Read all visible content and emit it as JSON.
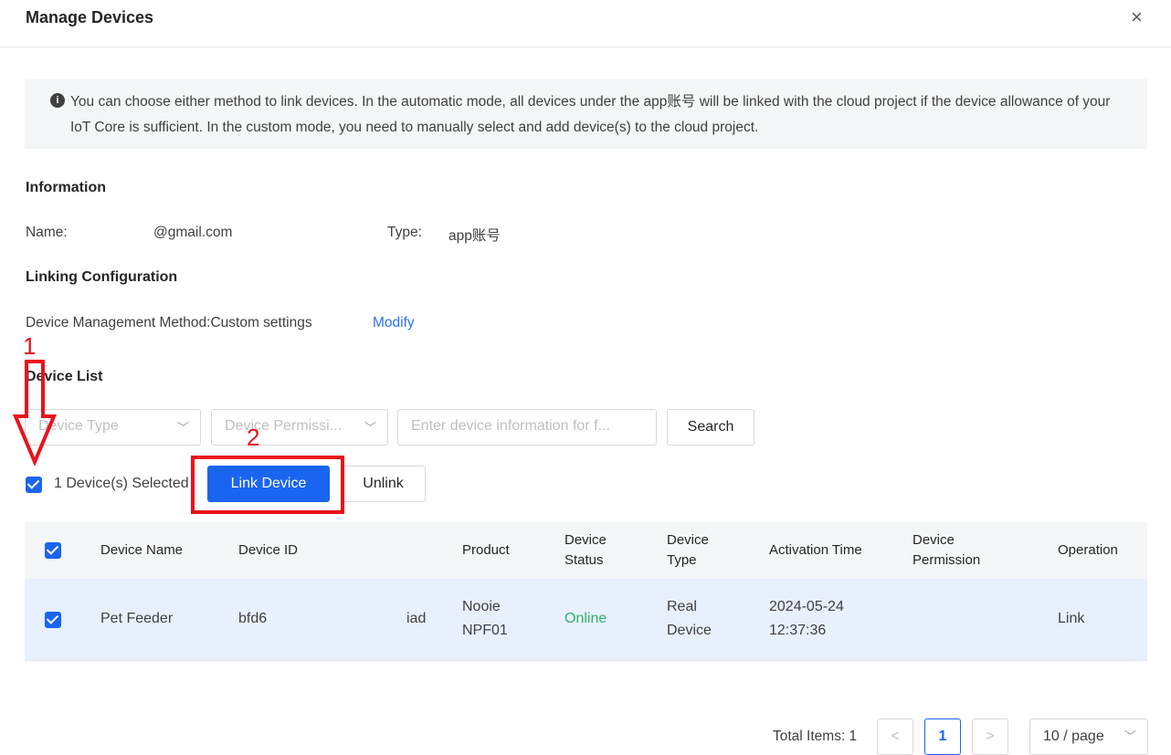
{
  "header": {
    "title": "Manage Devices",
    "close_icon": "×"
  },
  "notice": {
    "icon": "i",
    "text": "You can choose either method to link devices. In the automatic mode, all devices under the app账号 will be linked with the cloud project if the device allowance of your IoT Core is sufficient. In the custom mode, you need to manually select and add device(s) to the cloud project."
  },
  "information": {
    "heading": "Information",
    "name_label": "Name:",
    "name_value": "@gmail.com",
    "type_label": "Type:",
    "type_value": "app账号"
  },
  "linking": {
    "heading": "Linking Configuration",
    "method_text": "Device Management Method:Custom settings",
    "modify_label": "Modify"
  },
  "device_list": {
    "heading": "Device List",
    "filters": {
      "device_type_placeholder": "Device Type",
      "permission_placeholder": "Device Permissi...",
      "search_placeholder": "Enter device information for f...",
      "search_button": "Search"
    },
    "selected_text": "1 Device(s) Selected",
    "link_button": "Link Device",
    "unlink_button": "Unlink"
  },
  "table": {
    "columns": [
      "Device Name",
      "Device ID",
      "Product",
      "Device Status",
      "Device Type",
      "Activation Time",
      "Device Permission",
      "Operation"
    ],
    "rows": [
      {
        "device_name": "Pet Feeder",
        "device_id_start": "bfd6",
        "device_id_end": "iad",
        "product": "Nooie NPF01",
        "status": "Online",
        "type": "Real Device",
        "activation": "2024-05-24 12:37:36",
        "permission": "",
        "operation": "Link"
      }
    ]
  },
  "pagination": {
    "total": "Total Items: 1",
    "prev": "<",
    "current": "1",
    "next": ">",
    "page_size": "10 / page"
  },
  "annotations": {
    "step1": "1",
    "step2": "2"
  },
  "colors": {
    "primary": "#1a65f0",
    "online": "#30b06a",
    "annotation": "#e8121c",
    "selected_row": "#e8f0fe"
  }
}
